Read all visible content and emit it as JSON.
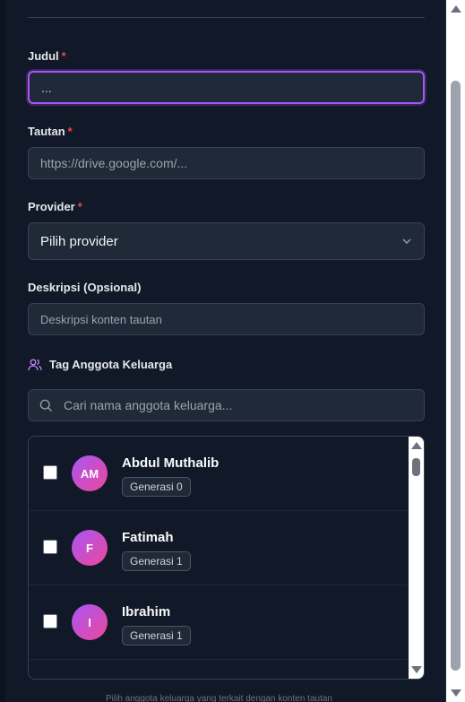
{
  "form": {
    "title_label": "Judul",
    "title_value": "...",
    "link_label": "Tautan",
    "link_placeholder": "https://drive.google.com/...",
    "provider_label": "Provider",
    "provider_selected": "Pilih provider",
    "description_label": "Deskripsi (Opsional)",
    "description_placeholder": "Deskripsi konten tautan",
    "required_mark": "*"
  },
  "tags": {
    "title": "Tag Anggota Keluarga",
    "search_placeholder": "Cari nama anggota keluarga...",
    "members": [
      {
        "initials": "AM",
        "name": "Abdul Muthalib",
        "generation": "Generasi 0",
        "checked": false
      },
      {
        "initials": "F",
        "name": "Fatimah",
        "generation": "Generasi 1",
        "checked": false
      },
      {
        "initials": "I",
        "name": "Ibrahim",
        "generation": "Generasi 1",
        "checked": false
      }
    ]
  },
  "footnote": "Pilih anggota keluarga yang terkait dengan konten tautan",
  "colors": {
    "accent": "#a855f7",
    "required": "#ef4444",
    "background": "#111827"
  }
}
